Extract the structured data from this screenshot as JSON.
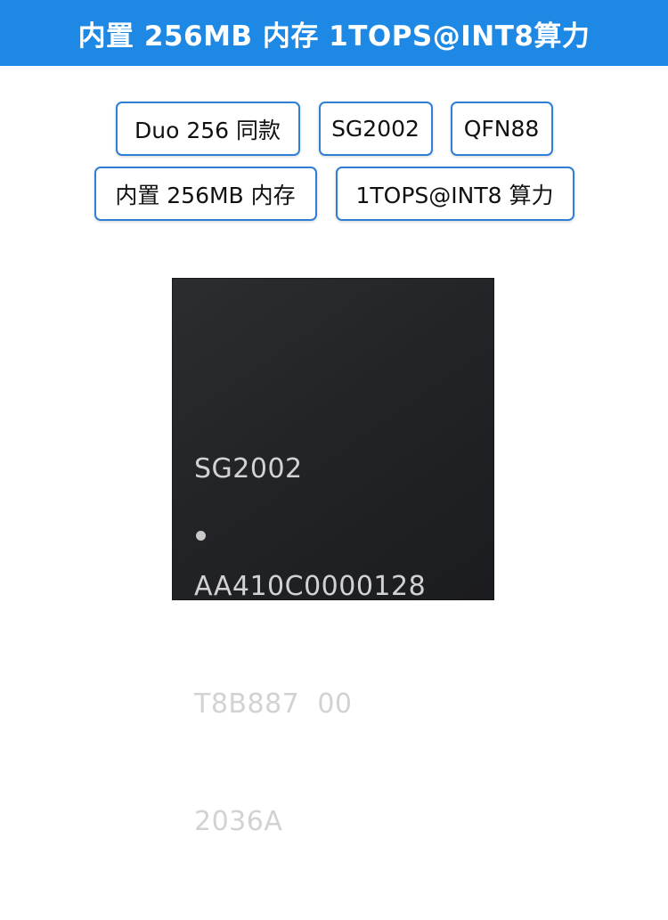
{
  "banner": {
    "title": "内置 256MB 内存 1TOPS@INT8算力",
    "background_color": "#1e88e5"
  },
  "tags": {
    "row1": [
      "Duo 256 同款",
      "SG2002",
      "QFN88"
    ],
    "row2": [
      "内置 256MB 内存",
      "1TOPS@INT8 算力"
    ],
    "border_color": "#2f7fd6"
  },
  "chip": {
    "markings": [
      "SG2002",
      "AA410C0000128",
      "T8B887  00",
      "2036A"
    ],
    "pin1_marker": "dot-icon"
  }
}
